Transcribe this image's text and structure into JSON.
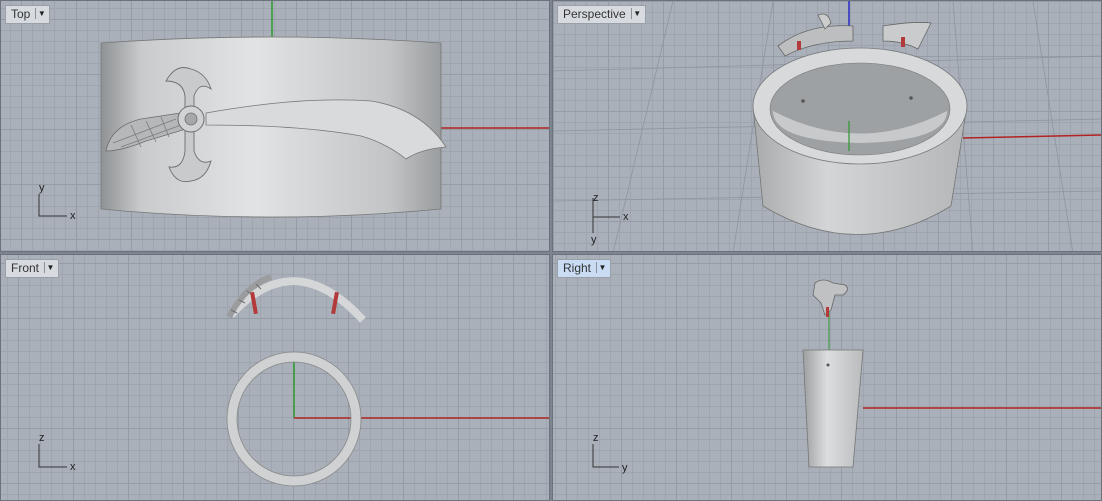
{
  "viewports": {
    "top": {
      "label": "Top",
      "axis_h": "x",
      "axis_v": "y"
    },
    "perspective": {
      "label": "Perspective",
      "axis_h": "x",
      "axis_v": "z",
      "axis_d": "y"
    },
    "front": {
      "label": "Front",
      "axis_h": "x",
      "axis_v": "z"
    },
    "right": {
      "label": "Right",
      "axis_h": "y",
      "axis_v": "z"
    }
  },
  "active_viewport": "right",
  "icons": {
    "viewport_menu": "dropdown-arrow-icon"
  },
  "colors": {
    "x_axis": "#b22222",
    "y_axis": "#2e9a2e",
    "z_axis": "#2b2bc8",
    "background": "#a9b0b9",
    "model": "#bfc1c3"
  }
}
